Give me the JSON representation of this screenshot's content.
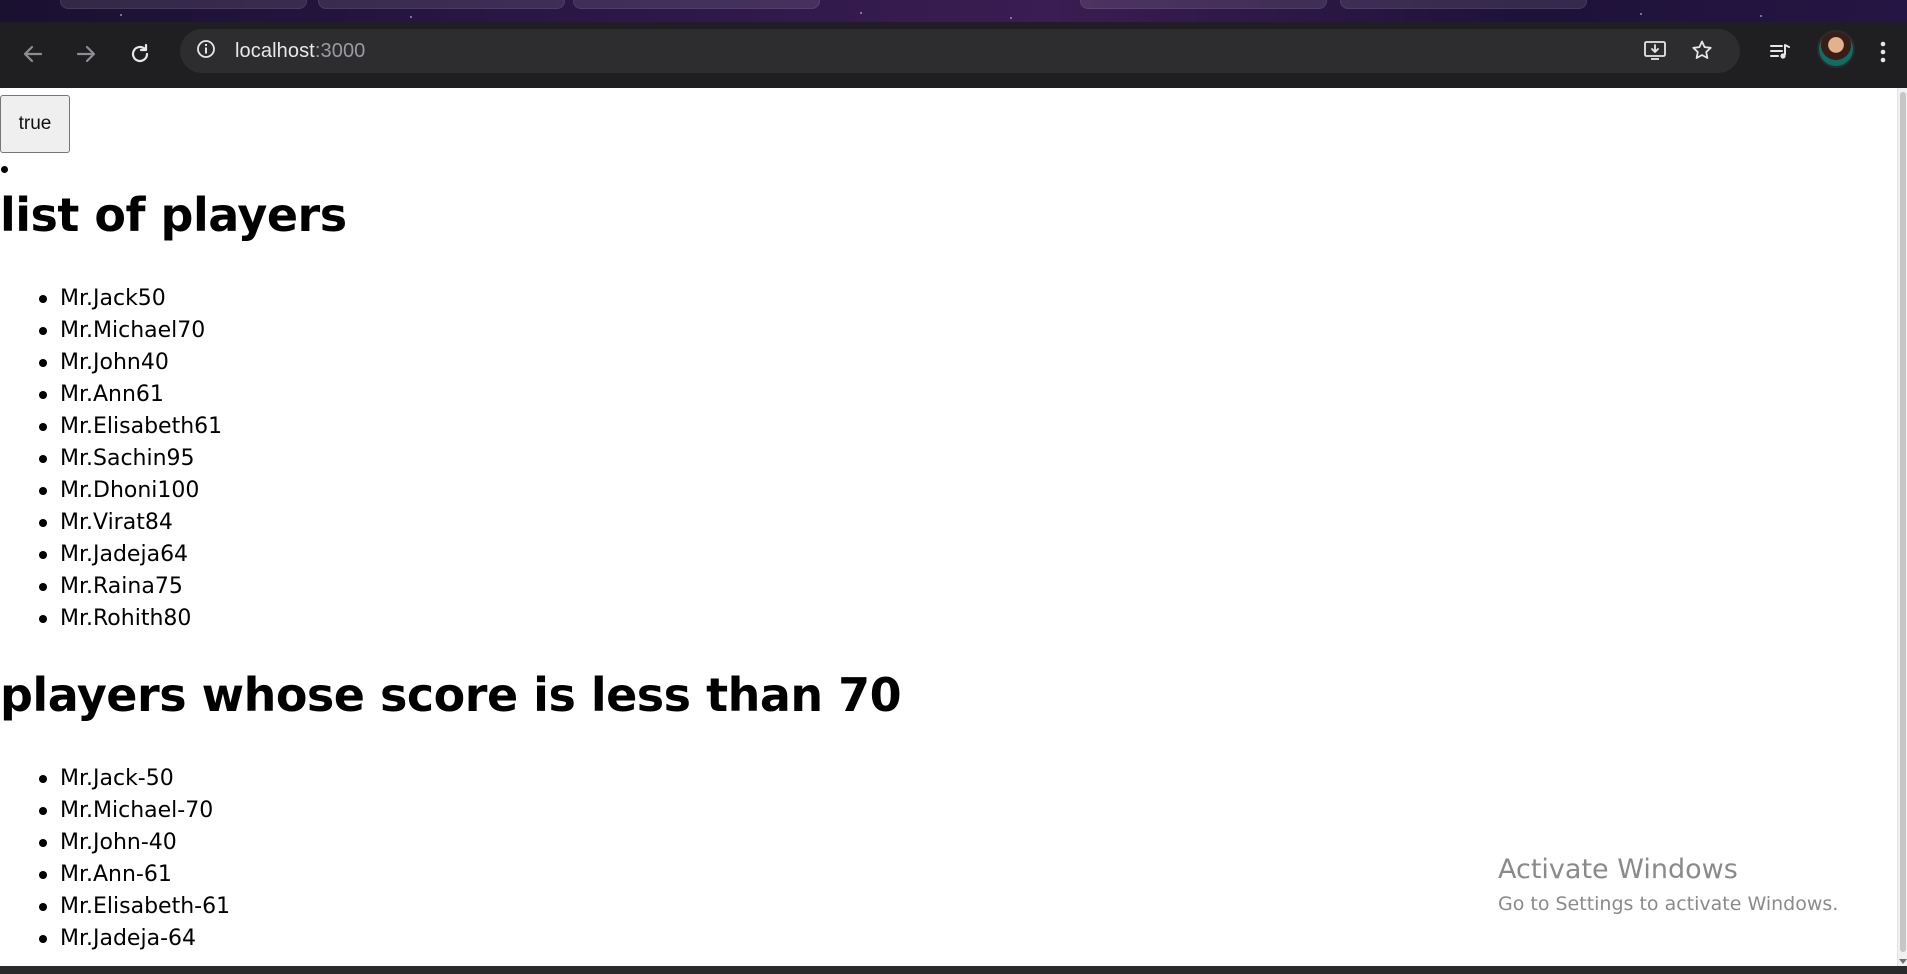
{
  "browser": {
    "url_host": "localhost",
    "url_port": ":3000",
    "icons": {
      "back": "arrow-left-icon",
      "forward": "arrow-right-icon",
      "reload": "reload-icon",
      "site_info": "info-icon",
      "install": "install-app-icon",
      "bookmark": "star-icon",
      "media": "media-queue-icon",
      "profile": "avatar",
      "menu": "kebab-menu-icon"
    }
  },
  "page": {
    "toggle_label": "true",
    "heading_all": "list of players",
    "players_all": [
      "Mr.Jack50",
      "Mr.Michael70",
      "Mr.John40",
      "Mr.Ann61",
      "Mr.Elisabeth61",
      "Mr.Sachin95",
      "Mr.Dhoni100",
      "Mr.Virat84",
      "Mr.Jadeja64",
      "Mr.Raina75",
      "Mr.Rohith80"
    ],
    "heading_less": "players whose score is less than 70",
    "players_less": [
      "Mr.Jack-50",
      "Mr.Michael-70",
      "Mr.John-40",
      "Mr.Ann-61",
      "Mr.Elisabeth-61",
      "Mr.Jadeja-64"
    ]
  },
  "watermark": {
    "title": "Activate Windows",
    "subtitle": "Go to Settings to activate Windows."
  },
  "colors": {
    "toolbar_bg": "#1f1f22",
    "omnibox_bg": "#2d2d30",
    "page_bg": "#ffffff",
    "watermark_text": "#8a8a8a"
  }
}
